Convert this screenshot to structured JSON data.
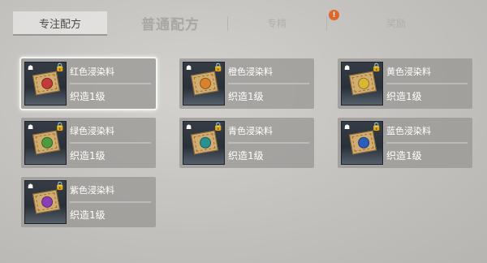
{
  "tabs": [
    {
      "label": "专注配方"
    },
    {
      "label": "普通配方"
    },
    {
      "label": "专精"
    },
    {
      "label": "奖励"
    }
  ],
  "tab_alert_icon": "!",
  "recipes": [
    {
      "name": "红色浸染料",
      "level": "织造1级",
      "dye_color": "#c23a3a"
    },
    {
      "name": "橙色浸染料",
      "level": "织造1级",
      "dye_color": "#d9822b"
    },
    {
      "name": "黄色浸染料",
      "level": "织造1级",
      "dye_color": "#d8b733"
    },
    {
      "name": "绿色浸染料",
      "level": "织造1级",
      "dye_color": "#4f9a3c"
    },
    {
      "name": "青色浸染料",
      "level": "织造1级",
      "dye_color": "#2a8f8f"
    },
    {
      "name": "蓝色浸染料",
      "level": "织造1级",
      "dye_color": "#2c5dbb"
    },
    {
      "name": "紫色浸染料",
      "level": "织造1级",
      "dye_color": "#8a3fb5"
    }
  ],
  "icons": {
    "lock": "lock-icon",
    "item": "dye-recipe-icon"
  },
  "colors": {
    "selected_border": "#f1f6f2",
    "card_bg": "#969492",
    "alert": "#e0672a"
  }
}
